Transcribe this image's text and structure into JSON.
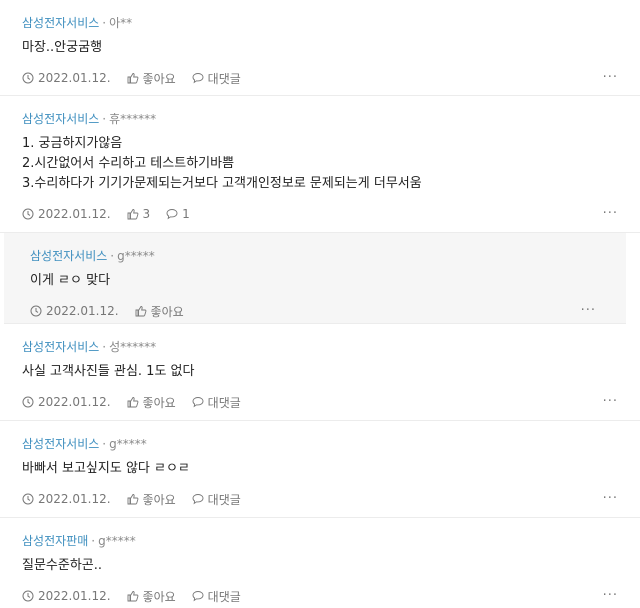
{
  "comments": [
    {
      "company": "삼성전자서비스",
      "user": "아**",
      "lines": [
        "마장..안궁굼행"
      ],
      "date": "2022.01.12.",
      "like_label": "좋아요",
      "reply_label": "대댓글",
      "reply": false
    },
    {
      "company": "삼성전자서비스",
      "user": "휴******",
      "lines": [
        "1. 궁금하지가않음",
        "2.시간없어서 수리하고 테스트하기바쁨",
        "3.수리하다가 기기가문제되는거보다 고객개인정보로 문제되는게 더무서움"
      ],
      "date": "2022.01.12.",
      "like_label": "3",
      "reply_label": "1",
      "reply": false
    },
    {
      "company": "삼성전자서비스",
      "user": "g*****",
      "lines": [
        "이게 ㄹㅇ 맞다"
      ],
      "date": "2022.01.12.",
      "like_label": "좋아요",
      "reply_label": null,
      "reply": true
    },
    {
      "company": "삼성전자서비스",
      "user": "성******",
      "lines": [
        "사실 고객사진들 관심. 1도 없다"
      ],
      "date": "2022.01.12.",
      "like_label": "좋아요",
      "reply_label": "대댓글",
      "reply": false
    },
    {
      "company": "삼성전자서비스",
      "user": "g*****",
      "lines": [
        "바빠서 보고싶지도 않다 ㄹㅇㄹ"
      ],
      "date": "2022.01.12.",
      "like_label": "좋아요",
      "reply_label": "대댓글",
      "reply": false
    },
    {
      "company": "삼성전자판매",
      "user": "g*****",
      "lines": [
        "질문수준하곤.."
      ],
      "date": "2022.01.12.",
      "like_label": "좋아요",
      "reply_label": "대댓글",
      "reply": false
    }
  ],
  "more_label": "···",
  "meta_separator": "·",
  "icons": {
    "date": "clock-icon",
    "like": "thumbs-up-icon",
    "reply": "speech-bubble-icon",
    "more": "more-dots-icon"
  },
  "colors": {
    "company": "#3f8fbf",
    "muted": "#888888",
    "reply_background": "#f6f6f6"
  }
}
